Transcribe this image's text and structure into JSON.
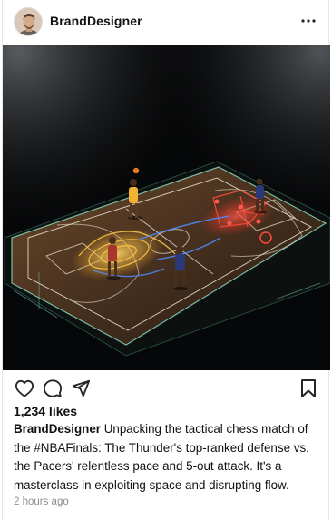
{
  "post": {
    "username": "BrandDesigner",
    "more_icon": "ellipsis-horizontal-icon",
    "image": {
      "subject": "basketball-court-tactics-illustration",
      "team_colors": {
        "left": "#f2b335",
        "right": "#e8413c",
        "court_glow": "#7cc9b8"
      }
    },
    "actions": {
      "like_icon": "heart-icon",
      "comment_icon": "comment-bubble-icon",
      "share_icon": "paper-plane-icon",
      "save_icon": "bookmark-icon"
    },
    "likes_text": "1,234 likes",
    "caption": {
      "username": "BrandDesigner",
      "text": "Unpacking the tactical chess match of the #NBAFinals: The Thunder's top-ranked defense vs. the Pacers' relentless pace and 5-out attack. It's a masterclass in exploiting space and disrupting flow."
    },
    "timestamp": "2 hours ago"
  }
}
